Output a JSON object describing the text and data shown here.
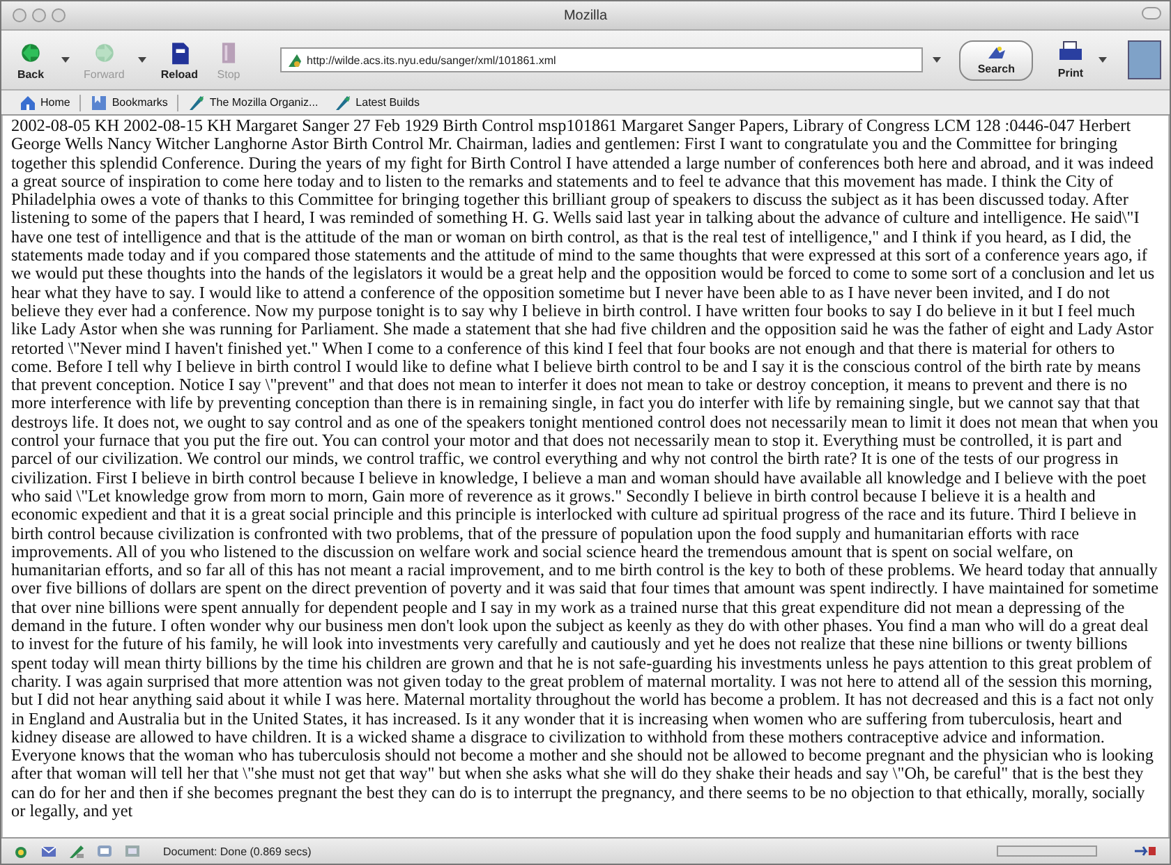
{
  "window": {
    "title": "Mozilla"
  },
  "toolbar": {
    "buttons": [
      {
        "label": "Back",
        "kind": "back",
        "disabled": false
      },
      {
        "label": "Forward",
        "kind": "forward",
        "disabled": true
      },
      {
        "label": "Reload",
        "kind": "reload",
        "disabled": false
      },
      {
        "label": "Stop",
        "kind": "stop",
        "disabled": true
      }
    ],
    "url": "http://wilde.acs.its.nyu.edu/sanger/xml/101861.xml",
    "search": "Search",
    "print": "Print"
  },
  "bookmarks": [
    {
      "label": "Home",
      "kind": "home"
    },
    {
      "label": "Bookmarks",
      "kind": "bookmarks"
    },
    {
      "label": "The Mozilla Organiz...",
      "kind": "link"
    },
    {
      "label": "Latest Builds",
      "kind": "link"
    }
  ],
  "document": {
    "text": "2002-08-05 KH 2002-08-15 KH Margaret Sanger 27 Feb 1929 Birth Control msp101861 Margaret Sanger Papers, Library of Congress LCM 128 :0446-047 Herbert George Wells Nancy Witcher Langhorne Astor Birth Control Mr. Chairman, ladies and gentlemen: First I want to congratulate you and the Committee for bringing together this splendid Conference. During the years of my fight for Birth Control I have attended a large number of conferences both here and abroad, and it was indeed a great source of inspiration to come here today and to listen to the remarks and statements and to feel te advance that this movement has made. I think the City of Philadelphia owes a vote of thanks to this Committee for bringing together this brilliant group of speakers to discuss the subject as it has been discussed today. After listening to some of the papers that I heard, I was reminded of something H. G. Wells said last year in talking about the advance of culture and intelligence. He said\\\"I have one test of intelligence and that is the attitude of the man or woman on birth control, as that is the real test of intelligence,\" and I think if you heard, as I did, the statements made today and if you compared those statements and the attitude of mind to the same thoughts that were expressed at this sort of a conference years ago, if we would put these thoughts into the hands of the legislators it would be a great help and the opposition would be forced to come to some sort of a conclusion and let us hear what they have to say. I would like to attend a conference of the opposition sometime but I never have been able to as I have never been invited, and I do not believe they ever had a conference. Now my purpose tonight is to say why I believe in birth control. I have written four books to say I do believe in it but I feel much like Lady Astor when she was running for Parliament. She made a statement that she had five children and the opposition said he was the father of eight and Lady Astor retorted \\\"Never mind I haven't finished yet.\" When I come to a conference of this kind I feel that four books are not enough and that there is material for others to come. Before I tell why I believe in birth control I would like to define what I believe birth control to be and I say it is the conscious control of the birth rate by means that prevent conception. Notice I say \\\"prevent\" and that does not mean to interfer it does not mean to take or destroy conception, it means to prevent and there is no more interference with life by preventing conception than there is in remaining single, in fact you do interfer with life by remaining single, but we cannot say that that destroys life. It does not, we ought to say control and as one of the speakers tonight mentioned control does not necessarily mean to limit it does not mean that when you control your furnace that you put the fire out. You can control your motor and that does not necessarily mean to stop it. Everything must be controlled, it is part and parcel of our civilization. We control our minds, we control traffic, we control everything and why not control the birth rate? It is one of the tests of our progress in civilization. First I believe in birth control because I believe in knowledge, I believe a man and woman should have available all knowledge and I believe with the poet who said \\\"Let knowledge grow from morn to morn, Gain more of reverence as it grows.\" Secondly I believe in birth control because I believe it is a health and economic expedient and that it is a great social principle and this principle is interlocked with culture ad spiritual progress of the race and its future. Third I believe in birth control because civilization is confronted with two problems, that of the pressure of population upon the food supply and humanitarian efforts with race improvements. All of you who listened to the discussion on welfare work and social science heard the tremendous amount that is spent on social welfare, on humanitarian efforts, and so far all of this has not meant a racial improvement, and to me birth control is the key to both of these problems. We heard today that annually over five billions of dollars are spent on the direct prevention of poverty and it was said that four times that amount was spent indirectly. I have maintained for sometime that over nine billions were spent annually for dependent people and I say in my work as a trained nurse that this great expenditure did not mean a depressing of the demand in the future. I often wonder why our business men don't look upon the subject as keenly as they do with other phases. You find a man who will do a great deal to invest for the future of his family, he will look into investments very carefully and cautiously and yet he does not realize that these nine billions or twenty billions spent today will mean thirty billions by the time his children are grown and that he is not safe-guarding his investments unless he pays attention to this great problem of charity. I was again surprised that more attention was not given today to the great problem of maternal mortality. I was not here to attend all of the session this morning, but I did not hear anything said about it while I was here. Maternal mortality throughout the world has become a problem. It has not decreased and this is a fact not only in England and Australia but in the United States, it has increased. Is it any wonder that it is increasing when women who are suffering from tuberculosis, heart and kidney disease are allowed to have children. It is a wicked shame a disgrace to civilization to withhold from these mothers contraceptive advice and information. Everyone knows that the woman who has tuberculosis should not become a mother and she should not be allowed to become pregnant and the physician who is looking after that woman will tell her that \\\"she must not get that way\" but when she asks what she will do they shake their heads and say \\\"Oh, be careful\" that is the best they can do for her and then if she becomes pregnant the best they can do is to interrupt the pregnancy, and there seems to be no objection to that ethically, morally, socially or legally, and yet"
  },
  "status_bar": {
    "text": "Document: Done (0.869 secs)"
  }
}
